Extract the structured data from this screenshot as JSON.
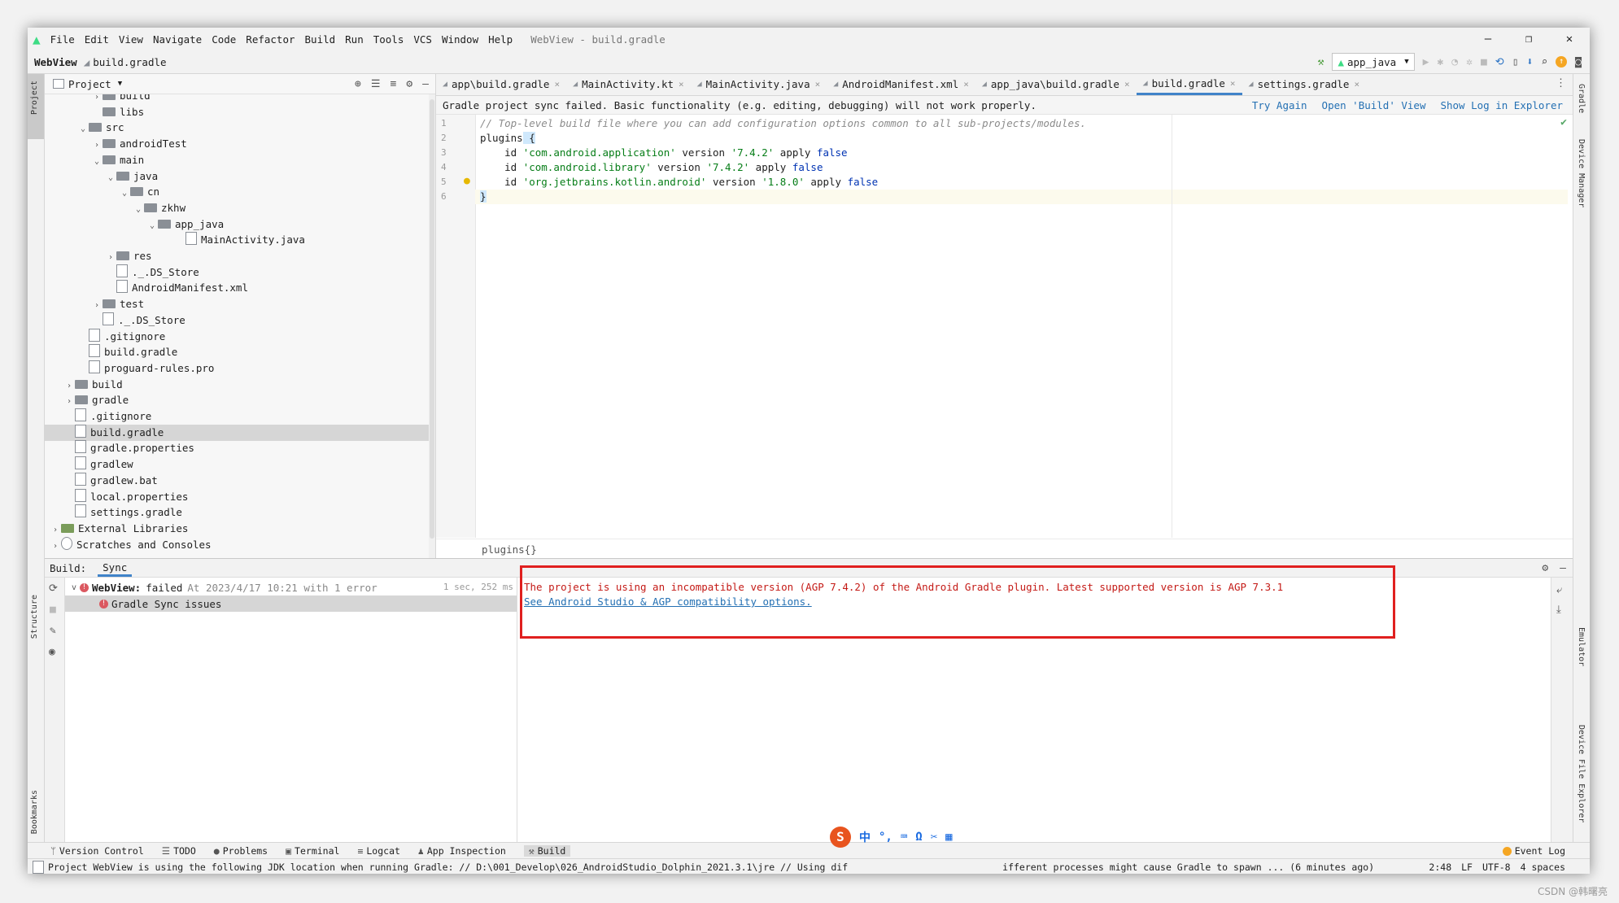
{
  "window": {
    "title": "WebView - build.gradle",
    "menu": [
      "File",
      "Edit",
      "View",
      "Navigate",
      "Code",
      "Refactor",
      "Build",
      "Run",
      "Tools",
      "VCS",
      "Window",
      "Help"
    ],
    "controls": [
      "—",
      "❐",
      "✕"
    ]
  },
  "navbar": {
    "project": "WebView",
    "file": "build.gradle",
    "run_config": "app_java"
  },
  "side_tabs": {
    "left_top": "Project",
    "left_structure": "Structure",
    "left_bookmarks": "Bookmarks",
    "right_gradle": "Gradle",
    "right_device_manager": "Device Manager",
    "right_emulator": "Emulator",
    "right_device_file_explorer": "Device File Explorer"
  },
  "project_panel": {
    "title": "Project",
    "items": [
      {
        "label": "build",
        "arrow": ">",
        "kind": "folder"
      },
      {
        "label": "libs",
        "arrow": "",
        "kind": "folder"
      },
      {
        "label": "src",
        "arrow": "v",
        "kind": "folder"
      },
      {
        "label": "androidTest",
        "arrow": ">",
        "kind": "folder"
      },
      {
        "label": "main",
        "arrow": "v",
        "kind": "folder"
      },
      {
        "label": "java",
        "arrow": "v",
        "kind": "folder"
      },
      {
        "label": "cn",
        "arrow": "v",
        "kind": "folder"
      },
      {
        "label": "zkhw",
        "arrow": "v",
        "kind": "folder"
      },
      {
        "label": "app_java",
        "arrow": "v",
        "kind": "folder"
      },
      {
        "label": "MainActivity.java",
        "arrow": "",
        "kind": "file"
      },
      {
        "label": "res",
        "arrow": ">",
        "kind": "folder"
      },
      {
        "label": "._.DS_Store",
        "arrow": "",
        "kind": "file"
      },
      {
        "label": "AndroidManifest.xml",
        "arrow": "",
        "kind": "file"
      },
      {
        "label": "test",
        "arrow": ">",
        "kind": "folder"
      },
      {
        "label": "._.DS_Store",
        "arrow": "",
        "kind": "file"
      },
      {
        "label": ".gitignore",
        "arrow": "",
        "kind": "file"
      },
      {
        "label": "build.gradle",
        "arrow": "",
        "kind": "file"
      },
      {
        "label": "proguard-rules.pro",
        "arrow": "",
        "kind": "file"
      },
      {
        "label": "build",
        "arrow": ">",
        "kind": "folder"
      },
      {
        "label": "gradle",
        "arrow": ">",
        "kind": "folder"
      },
      {
        "label": ".gitignore",
        "arrow": "",
        "kind": "file"
      },
      {
        "label": "build.gradle",
        "arrow": "",
        "kind": "file",
        "selected": true
      },
      {
        "label": "gradle.properties",
        "arrow": "",
        "kind": "file"
      },
      {
        "label": "gradlew",
        "arrow": "",
        "kind": "file"
      },
      {
        "label": "gradlew.bat",
        "arrow": "",
        "kind": "file"
      },
      {
        "label": "local.properties",
        "arrow": "",
        "kind": "file"
      },
      {
        "label": "settings.gradle",
        "arrow": "",
        "kind": "file"
      },
      {
        "label": "External Libraries",
        "arrow": ">",
        "kind": "lib"
      },
      {
        "label": "Scratches and Consoles",
        "arrow": ">",
        "kind": "scratch"
      }
    ]
  },
  "editor": {
    "tabs": [
      {
        "label": "app\\build.gradle"
      },
      {
        "label": "MainActivity.kt"
      },
      {
        "label": "MainActivity.java"
      },
      {
        "label": "AndroidManifest.xml"
      },
      {
        "label": "app_java\\build.gradle"
      },
      {
        "label": "build.gradle",
        "active": true
      },
      {
        "label": "settings.gradle"
      }
    ],
    "banner_text": "Gradle project sync failed. Basic functionality (e.g. editing, debugging) will not work properly.",
    "banner_links": [
      "Try Again",
      "Open 'Build' View",
      "Show Log in Explorer"
    ],
    "line_numbers": [
      "1",
      "2",
      "3",
      "4",
      "5",
      "6"
    ],
    "code": {
      "l1": "// Top-level build file where you can add configuration options common to all sub-projects/modules.",
      "l2_kw": "plugins",
      "l2_rest": " {",
      "l3_a": "    id ",
      "l3_s1": "'com.android.application'",
      "l3_b": " version ",
      "l3_s2": "'7.4.2'",
      "l3_c": " apply ",
      "l3_f": "false",
      "l4_a": "    id ",
      "l4_s1": "'com.android.library'",
      "l4_b": " version ",
      "l4_s2": "'7.4.2'",
      "l4_c": " apply ",
      "l4_f": "false",
      "l5_a": "    id ",
      "l5_s1": "'org.jetbrains.kotlin.android'",
      "l5_b": " version ",
      "l5_s2": "'1.8.0'",
      "l5_c": " apply ",
      "l5_f": "false",
      "l6": "}"
    },
    "breadcrumb": "plugins{}"
  },
  "build_panel": {
    "label": "Build:",
    "tab": "Sync",
    "tree_root_name": "WebView:",
    "tree_root_status": "failed",
    "tree_root_time": "At 2023/4/17 10:21 with 1 error",
    "tree_root_duration": "1 sec, 252 ms",
    "tree_child": "Gradle Sync issues",
    "console_error": "The project is using an incompatible version (AGP 7.4.2) of the Android Gradle plugin. Latest supported version is AGP 7.3.1",
    "console_link": "See Android Studio & AGP compatibility options."
  },
  "bottom_tools": [
    "Version Control",
    "TODO",
    "Problems",
    "Terminal",
    "Logcat",
    "App Inspection",
    "Build"
  ],
  "bottom_right": "Event Log",
  "status": {
    "message": "Project WebView is using the following JDK location when running Gradle: // D:\\001_Develop\\026_AndroidStudio_Dolphin_2021.3.1\\jre // Using dif",
    "message_tail": "ifferent processes might cause Gradle to spawn ... (6 minutes ago)",
    "position": "2:48",
    "line_sep": "LF",
    "encoding": "UTF-8",
    "indent": "4 spaces"
  },
  "ime": [
    "S",
    "中",
    "°,",
    "⌨",
    "Ω",
    "✂",
    "▦"
  ],
  "watermark": "CSDN @韩曙亮"
}
